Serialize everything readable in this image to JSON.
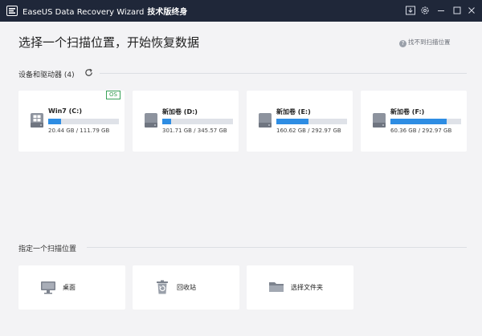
{
  "app": {
    "title": "EaseUS Data Recovery Wizard",
    "subtitle": "技术版终身"
  },
  "header": {
    "title": "选择一个扫描位置，开始恢复数据",
    "help_link": "找不到扫描位置"
  },
  "drives_section": {
    "label": "设备和驱动器 (4)"
  },
  "drives": [
    {
      "name": "Win7 (C:)",
      "size": "20.44 GB / 111.79 GB",
      "used_fraction": 0.18,
      "badge": "OS",
      "icon": "windows-drive-icon"
    },
    {
      "name": "新加卷 (D:)",
      "size": "301.71 GB / 345.57 GB",
      "used_fraction": 0.13,
      "badge": "",
      "icon": "hard-drive-icon"
    },
    {
      "name": "新加卷 (E:)",
      "size": "160.62 GB / 292.97 GB",
      "used_fraction": 0.45,
      "badge": "",
      "icon": "hard-drive-icon"
    },
    {
      "name": "新加卷 (F:)",
      "size": "60.36 GB / 292.97 GB",
      "used_fraction": 0.79,
      "badge": "",
      "icon": "hard-drive-icon"
    }
  ],
  "location_section": {
    "label": "指定一个扫描位置"
  },
  "locations": [
    {
      "label": "桌面",
      "icon": "desktop-icon"
    },
    {
      "label": "回收站",
      "icon": "recycle-bin-icon"
    },
    {
      "label": "选择文件夹",
      "icon": "folder-icon"
    }
  ],
  "colors": {
    "titlebar": "#1f2739",
    "accent": "#2e8de3",
    "os_badge": "#3aa35a",
    "background": "#f3f3f5"
  }
}
